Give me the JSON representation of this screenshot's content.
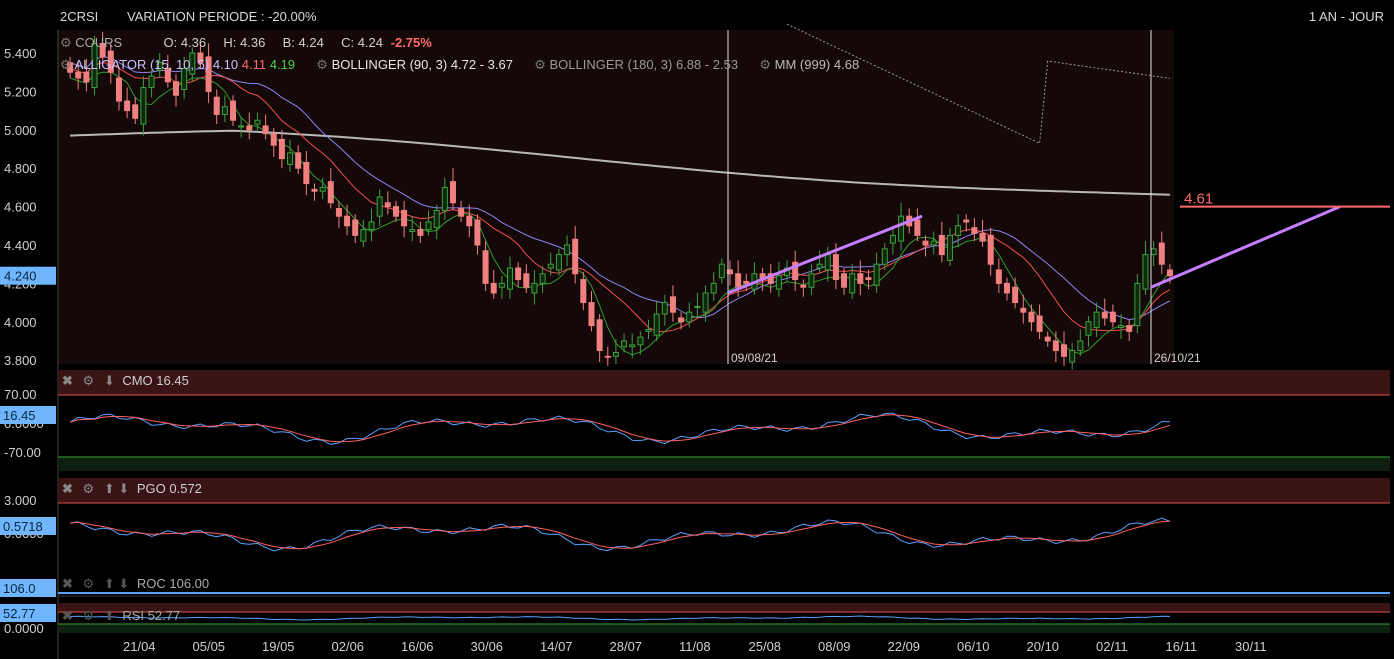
{
  "header": {
    "ticker": "2CRSI",
    "variation": "VARIATION PERIODE : -20.00%",
    "period": "1 AN - JOUR"
  },
  "legend": {
    "cours": {
      "label": "COURS",
      "o_label": "O:",
      "o": "4.36",
      "h_label": "H:",
      "h": "4.36",
      "b_label": "B:",
      "b": "4.24",
      "c_label": "C:",
      "c": "4.24",
      "change": "-2.75%"
    },
    "alligator": {
      "label": "ALLIGATOR (15, 10, 5)",
      "v1": "4.10",
      "v2": "4.11",
      "v3": "4.19"
    },
    "bollinger1": {
      "label": "BOLLINGER (90, 3)",
      "value": "4.72 - 3.67"
    },
    "bollinger2": {
      "label": "BOLLINGER (180, 3)",
      "value": "6.88 - 2.53"
    },
    "mm": {
      "label": "MM (999)",
      "value": "4.68"
    }
  },
  "colors": {
    "up": "#3fa03f",
    "down": "#f08080",
    "jaw": "#8b86f0",
    "teeth": "#f05050",
    "lips": "#2e9e2e",
    "ma": "#b8b8b8",
    "trend": "#c77dff",
    "level": "#ff6b6b",
    "badge": "#6fb6ff"
  },
  "chart_data": [
    {
      "type": "candlestick",
      "name": "COURS",
      "x": [
        "21/04",
        "05/05",
        "19/05",
        "02/06",
        "16/06",
        "30/06",
        "14/07",
        "28/07",
        "11/08",
        "25/08",
        "08/09",
        "22/09",
        "06/10",
        "20/10",
        "02/11",
        "16/11",
        "30/11"
      ],
      "yticks": [
        3.8,
        4.0,
        4.2,
        4.4,
        4.6,
        4.8,
        5.0,
        5.2,
        5.4
      ],
      "ylim": [
        3.78,
        5.52
      ],
      "last": "4.240",
      "markers": [
        "09/08/21",
        "26/10/21"
      ],
      "level": "4.61",
      "closes": [
        5.3,
        5.27,
        5.25,
        5.45,
        5.38,
        5.3,
        5.15,
        5.1,
        5.06,
        5.22,
        5.28,
        5.35,
        5.25,
        5.18,
        5.32,
        5.4,
        5.35,
        5.2,
        5.08,
        5.12,
        5.05,
        5.02,
        5.0,
        5.05,
        4.98,
        4.92,
        4.85,
        4.88,
        4.8,
        4.72,
        4.68,
        4.7,
        4.62,
        4.55,
        4.5,
        4.45,
        4.48,
        4.52,
        4.65,
        4.6,
        4.55,
        4.5,
        4.48,
        4.45,
        4.52,
        4.58,
        4.7,
        4.62,
        4.55,
        4.5,
        4.4,
        4.2,
        4.15,
        4.2,
        4.28,
        4.22,
        4.18,
        4.2,
        4.25,
        4.3,
        4.35,
        4.4,
        4.25,
        4.1,
        3.98,
        3.85,
        3.82,
        3.84,
        3.9,
        3.88,
        3.92,
        3.96,
        4.04,
        4.1,
        4.05,
        4.0,
        4.05,
        4.08,
        4.15,
        4.2,
        4.3,
        4.25,
        4.18,
        4.2,
        4.25,
        4.22,
        4.2,
        4.24,
        4.28,
        4.22,
        4.18,
        4.25,
        4.3,
        4.35,
        4.22,
        4.18,
        4.25,
        4.2,
        4.22,
        4.3,
        4.38,
        4.45,
        4.55,
        4.5,
        4.45,
        4.4,
        4.42,
        4.35,
        4.45,
        4.5,
        4.52,
        4.46,
        4.42,
        4.3,
        4.2,
        4.15,
        4.1,
        4.05,
        4.0,
        3.95,
        3.9,
        3.85,
        3.82,
        3.85,
        3.9,
        4.0,
        4.05,
        4.02,
        4.0,
        3.98,
        3.95,
        4.2,
        4.35,
        4.38,
        4.3,
        4.24
      ]
    },
    {
      "type": "line",
      "name": "CMO",
      "value": "16.45",
      "badge": "16.45",
      "yticks": [
        "70.00",
        "0.0000",
        "-70.00"
      ]
    },
    {
      "type": "line",
      "name": "PGO",
      "value": "0.572",
      "badge": "0.5718",
      "yticks": [
        "3.000",
        "0.0000"
      ]
    },
    {
      "type": "line",
      "name": "ROC",
      "value": "106.00",
      "badge": "106.0"
    },
    {
      "type": "line",
      "name": "RSI",
      "value": "52.77",
      "badge": "52.77",
      "yticks": [
        "0.0000"
      ]
    }
  ],
  "panels": {
    "cmo": {
      "title": "CMO 16.45"
    },
    "pgo": {
      "title": "PGO 0.572"
    },
    "roc": {
      "title": "ROC 106.00"
    },
    "rsi": {
      "title": "RSI 52.77"
    }
  }
}
